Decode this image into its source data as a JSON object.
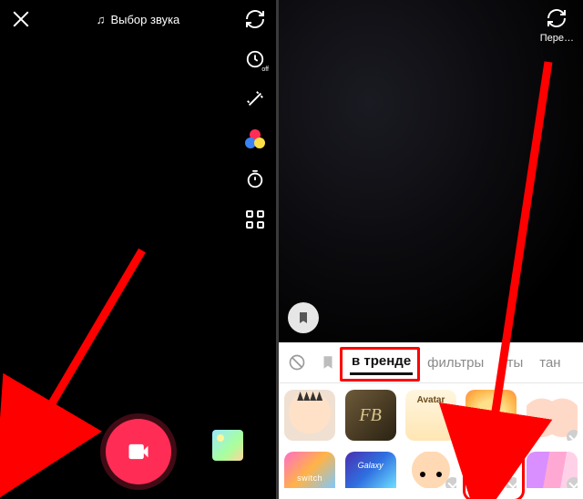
{
  "left": {
    "sound_select_label": "Выбор звука",
    "tool_labels": {
      "flip": "flip",
      "speed": "speed",
      "beauty": "beauty",
      "filters": "filters",
      "timer": "timer",
      "more": "more"
    }
  },
  "right": {
    "flip_label": "Пере…",
    "tabs": {
      "none": "none",
      "bookmark": "bookmark",
      "trending": "в тренде",
      "filters": "фильтры",
      "cat3_partial": "эты",
      "cat4_partial": "тан"
    },
    "effects": [
      {
        "name": "crown-face",
        "label": ""
      },
      {
        "name": "fb-monogram",
        "label": "FB"
      },
      {
        "name": "avatar",
        "label": "Avatar"
      },
      {
        "name": "golden-glow",
        "label": ""
      },
      {
        "name": "twin-faces",
        "label": ""
      },
      {
        "name": "melody-switch",
        "label": "switch"
      },
      {
        "name": "galaxy-shake",
        "label": "Galaxy"
      },
      {
        "name": "big-face",
        "label": ""
      },
      {
        "name": "devil-fork",
        "label": ""
      },
      {
        "name": "purple-brush",
        "label": ""
      }
    ]
  },
  "annotations": {
    "arrow1_desc": "red arrow pointing to effects button (left screen)",
    "arrow2_desc": "red arrow pointing to devil-fork effect (right screen)",
    "redbox_trending_desc": "red box around 'в тренде' tab",
    "redbox_effect_desc": "red rounded box around devil-fork effect thumbnail"
  }
}
